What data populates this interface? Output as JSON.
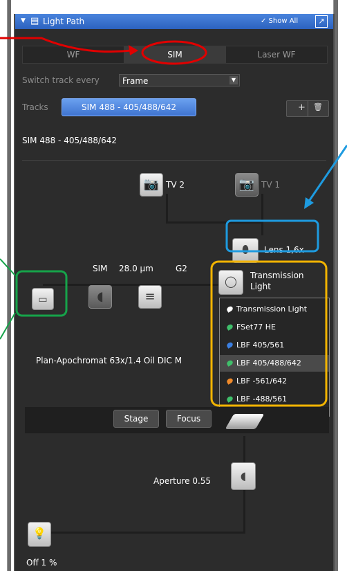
{
  "header": {
    "title": "Light Path",
    "show_all": "✓ Show All",
    "collapse_glyph": "▼",
    "panel_glyph": "▤",
    "external_glyph": "↗"
  },
  "mode_tabs": [
    {
      "label": "WF"
    },
    {
      "label": "SIM"
    },
    {
      "label": "Laser WF"
    }
  ],
  "switch_track": {
    "label": "Switch track every",
    "value": "Frame"
  },
  "tracks": {
    "label": "Tracks",
    "selected": "SIM 488 - 405/488/642"
  },
  "track_controls": {
    "add": "+",
    "delete": "🗑"
  },
  "section_title": "SIM 488 - 405/488/642",
  "tv2_label": "TV 2",
  "tv1_label": "TV 1",
  "lens_label": "Lens 1,6x",
  "sim_label": "SIM",
  "grating_label": "28.0 µm",
  "g2_label": "G2",
  "transmission_label": "Transmission\nLight",
  "objective_label": "Plan-Apochromat 63x/1.4 Oil DIC M",
  "popup_items": [
    {
      "label": "Transmission Light",
      "color": "#ffffff"
    },
    {
      "label": "FSet77 HE",
      "color": "#3fbf6a"
    },
    {
      "label": "LBF 405/561",
      "color": "#3b7fe0"
    },
    {
      "label": "LBF 405/488/642",
      "color": "#3fbf6a"
    },
    {
      "label": "LBF -561/642",
      "color": "#f08a2a"
    },
    {
      "label": "LBF -488/561",
      "color": "#3fbf6a"
    }
  ],
  "popup_selected_index": 3,
  "stage_button": "Stage",
  "focus_button": "Focus",
  "aperture_label": "Aperture 0.55",
  "lamp_label": "Off 1 %",
  "annotation_colors": {
    "red": "#e00000",
    "blue": "#1e9be0",
    "green": "#16a34a",
    "yellow": "#f2b400"
  }
}
